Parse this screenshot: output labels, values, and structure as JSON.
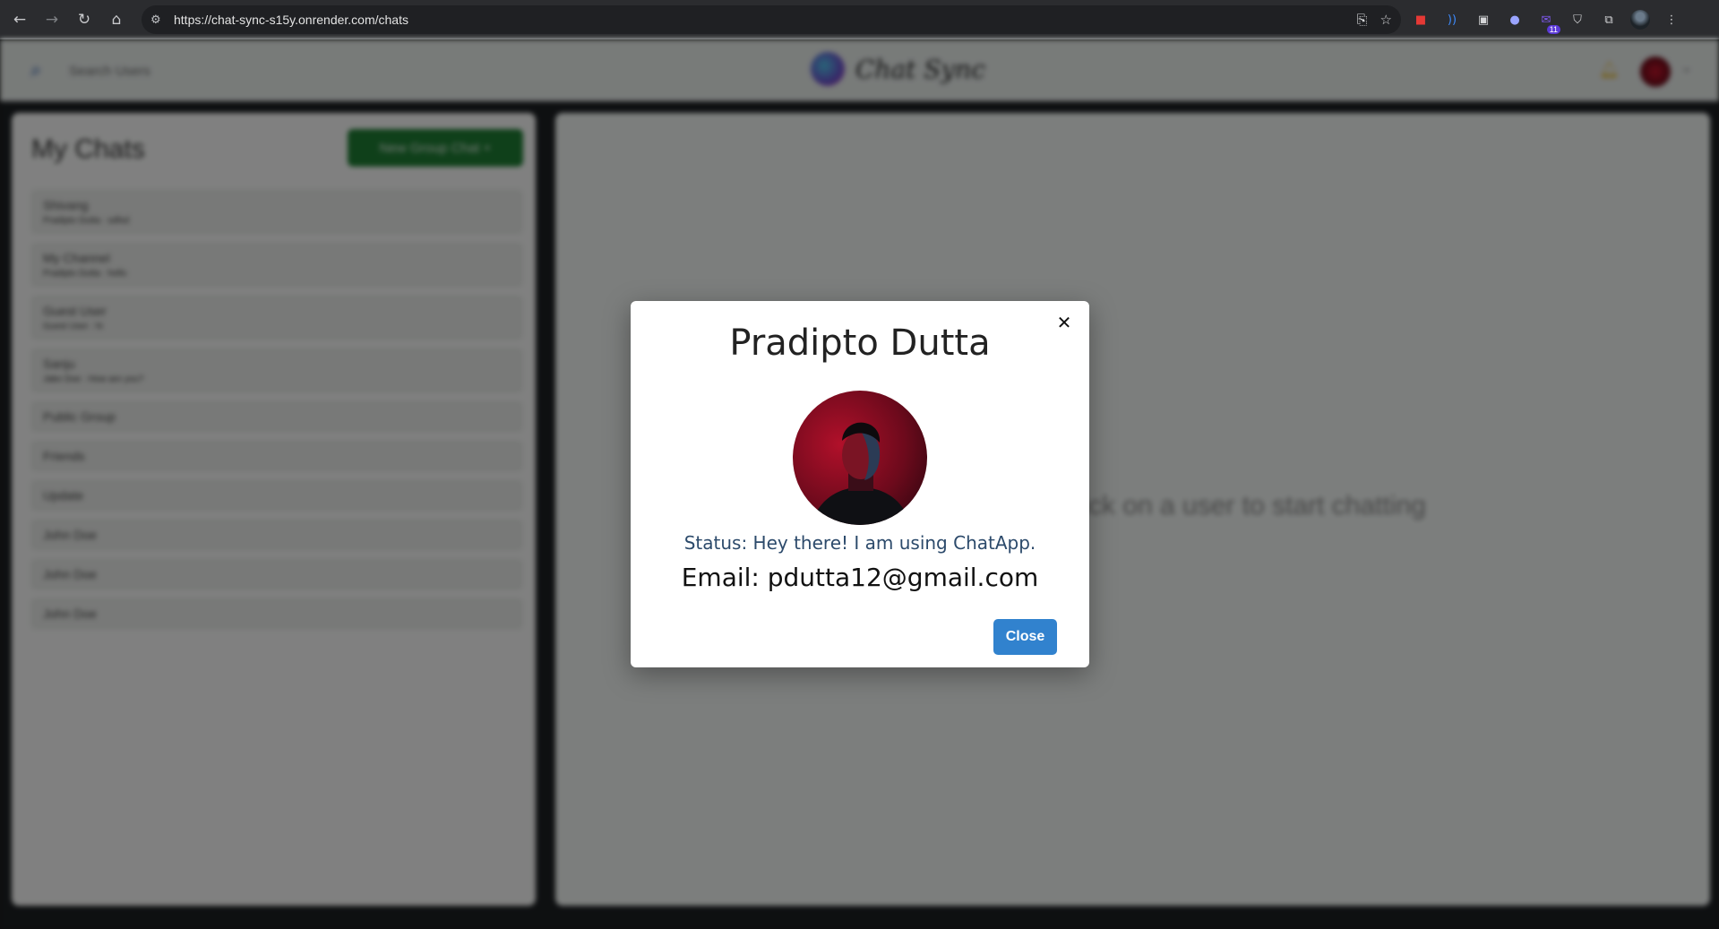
{
  "browser": {
    "url": "https://chat-sync-s15y.onrender.com/chats",
    "extensions": [
      {
        "name": "lock-extension-icon",
        "color": "#e53935"
      },
      {
        "name": "wave-extension-icon",
        "color": "#3d8bfd"
      },
      {
        "name": "window-extension-icon",
        "color": "#d5d6d8"
      },
      {
        "name": "cursor-extension-icon",
        "color": "#9aa4ff"
      },
      {
        "name": "mail-extension-icon",
        "color": "#7f5af0",
        "badge": "11"
      },
      {
        "name": "shield-extension-icon",
        "color": "#d5d6d8"
      },
      {
        "name": "puzzle-extension-icon",
        "color": "#d5d6d8"
      }
    ]
  },
  "app": {
    "search_label": "Search Users",
    "brand_name": "Chat Sync",
    "panel_title": "My Chats",
    "new_group_label": "New Group Chat +",
    "chats": [
      {
        "name": "Shivang",
        "meta": "Pradipto Dutta : sdfsd"
      },
      {
        "name": "My Channel",
        "meta": "Pradipto Dutta : hello"
      },
      {
        "name": "Guest User",
        "meta": "Guest User : hi"
      },
      {
        "name": "Sanju",
        "meta": "Jake Doe : How are you?"
      },
      {
        "name": "Public Group",
        "meta": ""
      },
      {
        "name": "Friends",
        "meta": ""
      },
      {
        "name": "Update",
        "meta": ""
      },
      {
        "name": "John Doe",
        "meta": ""
      },
      {
        "name": "John Doe",
        "meta": ""
      },
      {
        "name": "John Doe",
        "meta": ""
      }
    ],
    "placeholder": "Click on a user to start chatting"
  },
  "modal": {
    "title": "Pradipto Dutta",
    "status": "Status: Hey there! I am using ChatApp.",
    "email": "Email: pdutta12@gmail.com",
    "close_label": "Close",
    "accent_color": "#3182ce"
  }
}
